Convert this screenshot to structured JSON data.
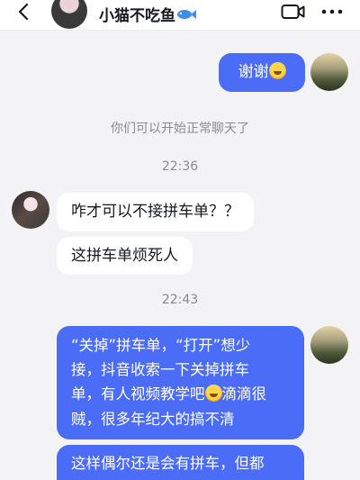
{
  "header": {
    "title": "小猫不吃鱼",
    "title_icon": "fish-icon",
    "back_icon": "chevron-left-icon",
    "video_icon": "video-camera-icon",
    "more_icon": "more-dots-icon"
  },
  "messages": {
    "m1": {
      "text": "谢谢"
    },
    "sys1": "你们可以开始正常聊天了",
    "time1": "22:36",
    "m2": {
      "text": "咋才可以不接拼车单？？"
    },
    "m3": {
      "text": "这拼车单烦死人"
    },
    "time2": "22:43",
    "m4": {
      "line1": "“关掉”拼车单，“打开”想少",
      "line2": "接，抖音收索一下关掉拼车",
      "line3a": "单，有人视频教学吧",
      "line3b": "滴滴很",
      "line4": "贼，很多年纪大的搞不清"
    },
    "m5": {
      "text": "这样偶尔还是会有拼车，但都"
    }
  },
  "colors": {
    "outgoing_bubble": "#4b6cf7",
    "incoming_bubble": "#ffffff",
    "background": "#f3f3f5"
  }
}
